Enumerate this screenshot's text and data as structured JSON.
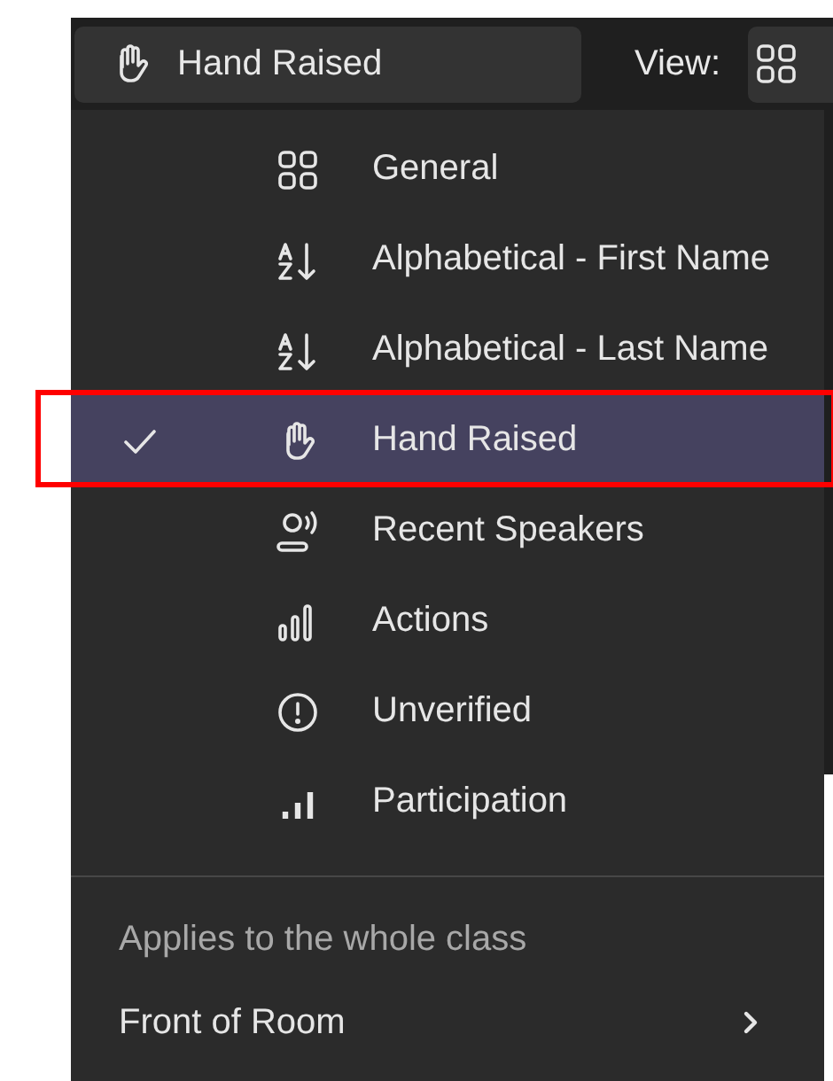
{
  "toolbar": {
    "sort_button": {
      "label": "Hand Raised"
    },
    "view_label": "View:"
  },
  "sort_menu": {
    "items": [
      {
        "label": "General",
        "selected": false
      },
      {
        "label": "Alphabetical - First Name",
        "selected": false
      },
      {
        "label": "Alphabetical - Last Name",
        "selected": false
      },
      {
        "label": "Hand Raised",
        "selected": true
      },
      {
        "label": "Recent Speakers",
        "selected": false
      },
      {
        "label": "Actions",
        "selected": false
      },
      {
        "label": "Unverified",
        "selected": false
      },
      {
        "label": "Participation",
        "selected": false
      }
    ],
    "section_label": "Applies to the whole class",
    "submenu": {
      "label": "Front of Room"
    }
  }
}
